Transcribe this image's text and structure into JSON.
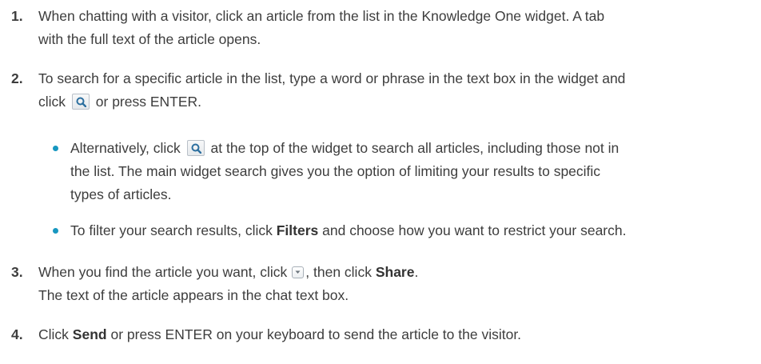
{
  "steps": [
    {
      "number": "1.",
      "line1": "When chatting with a visitor, click an article from the list in the Knowledge One widget. A tab",
      "line2": "with the full text of the article opens."
    },
    {
      "number": "2.",
      "line1": "To search for a specific article in the list, type a word or phrase in the text box in the widget and",
      "line2_before": "click",
      "line2_after": "or press ENTER.",
      "bullets": [
        {
          "line1_before": "Alternatively, click",
          "line1_after": "at the top of the widget to search all articles, including those not in",
          "line2": "the list. The main widget search gives you the option of limiting your results to specific",
          "line3": "types of articles."
        },
        {
          "text_before": "To filter your search results, click",
          "bold": "Filters",
          "text_after": "and choose how you want to restrict your search."
        }
      ]
    },
    {
      "number": "3.",
      "line1_before": "When you find the article you want, click",
      "line1_middle": ", then click",
      "bold": "Share",
      "line1_after": ".",
      "line2": "The text of the article appears in the chat text box."
    },
    {
      "number": "4.",
      "text_before": "Click",
      "bold": "Send",
      "text_after": "or press ENTER on your keyboard to send the article to the visitor."
    }
  ],
  "icons": {
    "search": "search-icon",
    "dropdown": "chevron-down-icon",
    "bullet_color": "#1797c0"
  }
}
